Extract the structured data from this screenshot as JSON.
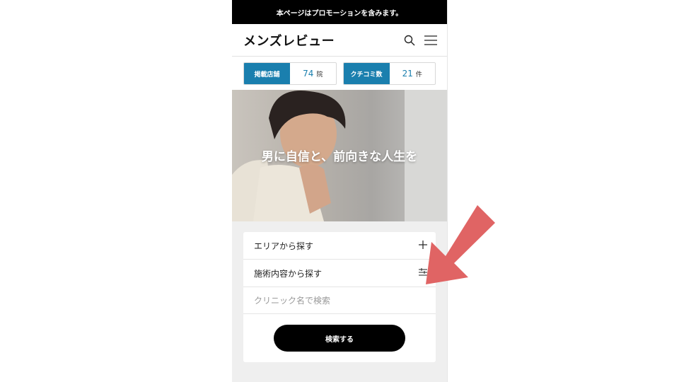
{
  "promo_banner": "本ページはプロモーションを含みます。",
  "header": {
    "logo": "メンズレビュー",
    "icons": [
      "search-icon",
      "menu-icon"
    ]
  },
  "stats": [
    {
      "label": "掲載店舗",
      "value": "74",
      "unit": "院"
    },
    {
      "label": "クチコミ数",
      "value": "21",
      "unit": "件"
    }
  ],
  "hero": {
    "tagline": "男に自信と、前向きな人生を"
  },
  "search": {
    "area_label": "エリアから探す",
    "area_icon": "plus-icon",
    "treatment_label": "施術内容から探す",
    "treatment_icon": "filter-icon",
    "clinic_placeholder": "クリニック名で検索",
    "button_label": "検索する"
  },
  "colors": {
    "accent": "#1a7fae",
    "arrow": "#e06464",
    "promo_bg": "#000000"
  }
}
